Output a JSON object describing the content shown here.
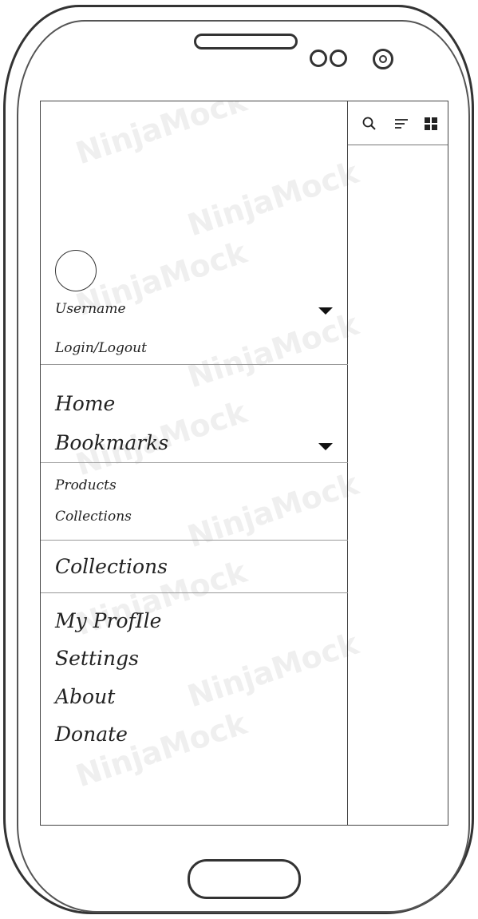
{
  "account": {
    "username": "Username",
    "login_logout": "Login/Logout"
  },
  "nav_primary": {
    "home": "Home",
    "bookmarks": "Bookmarks"
  },
  "bookmarks_submenu": {
    "products": "Products",
    "collections": "Collections"
  },
  "nav_secondary": {
    "collections": "Collections"
  },
  "nav_footer": {
    "my_profile": "My ProfIle",
    "settings": "Settings",
    "about": "About",
    "donate": "Donate"
  },
  "toolbar": {
    "icons": [
      "search-icon",
      "sort-icon",
      "grid-view-icon"
    ]
  },
  "watermark": {
    "text": "NinjaMock"
  }
}
